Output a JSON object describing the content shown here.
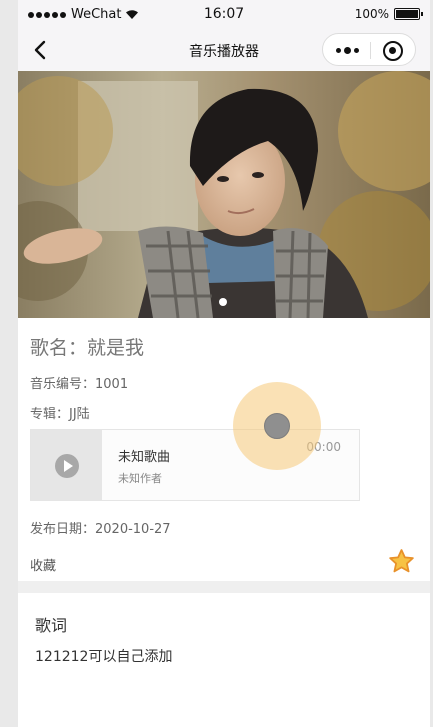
{
  "status_bar": {
    "carrier": "WeChat",
    "time": "16:07",
    "battery": "100%"
  },
  "nav": {
    "title": "音乐播放器"
  },
  "banner": {
    "page_indicator": {
      "current": 1,
      "total": 1
    }
  },
  "song": {
    "title": "歌名：就是我",
    "code": "音乐编号：1001",
    "album": "专辑：JJ陆",
    "release_date": "发布日期：2020-10-27",
    "favorite_label": "收藏"
  },
  "player": {
    "name": "未知歌曲",
    "author": "未知作者",
    "time": "00:00"
  },
  "lyrics": {
    "title": "歌词",
    "text": "121212可以自己添加"
  },
  "colors": {
    "star": "#f5a623",
    "touch": "#f5c878"
  }
}
